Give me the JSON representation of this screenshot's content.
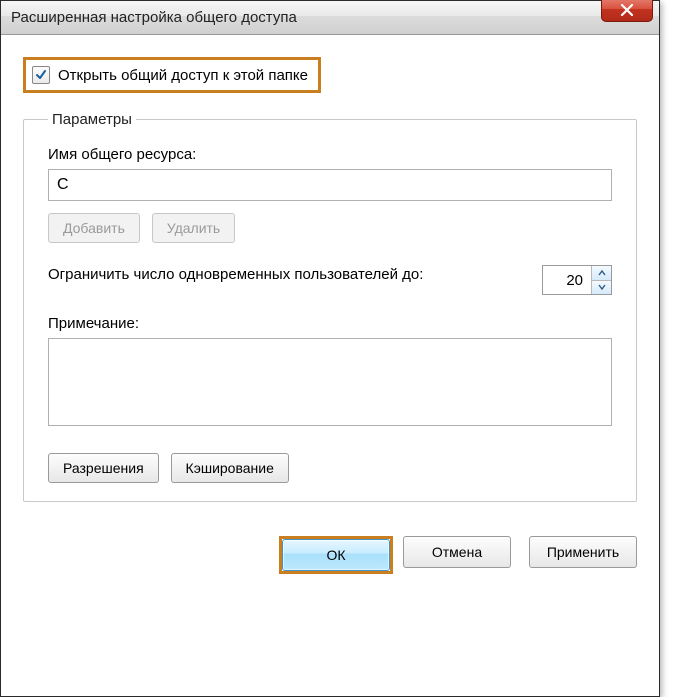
{
  "window": {
    "title": "Расширенная настройка общего доступа"
  },
  "share_checkbox": {
    "label": "Открыть общий доступ к этой папке",
    "checked": true
  },
  "params": {
    "legend": "Параметры",
    "share_name_label": "Имя общего ресурса:",
    "share_name_value": "C",
    "add_button": "Добавить",
    "remove_button": "Удалить",
    "limit_label": "Ограничить число одновременных пользователей до:",
    "limit_value": "20",
    "note_label": "Примечание:",
    "note_value": "",
    "permissions_button": "Разрешения",
    "caching_button": "Кэширование"
  },
  "footer": {
    "ok": "ОК",
    "cancel": "Отмена",
    "apply": "Применить"
  }
}
